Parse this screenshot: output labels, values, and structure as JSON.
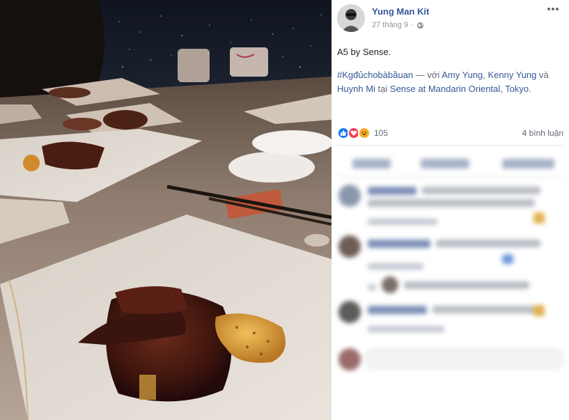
{
  "post": {
    "author": "Yung Man Kit",
    "date": "27 tháng 9",
    "privacy_icon": "globe-icon",
    "caption": "A5 by Sense.",
    "hashtag": "#Kgđủchobàbầuan",
    "with_prefix": "— với",
    "tagged_1": "Amy Yung",
    "separator": ",",
    "tagged_2": "Kenny Yung",
    "and_word": "và",
    "tagged_3": "Huynh Mi",
    "at_word": "tại",
    "place": "Sense at Mandarin Oriental, Tokyo",
    "place_end": "."
  },
  "reactions": {
    "icons": [
      "like-icon",
      "love-icon",
      "haha-icon"
    ],
    "count": "105",
    "comments": "4 bình luận"
  },
  "colors": {
    "link": "#365899",
    "like": "#1877f2",
    "love": "#f33e58",
    "haha": "#f7b125"
  }
}
